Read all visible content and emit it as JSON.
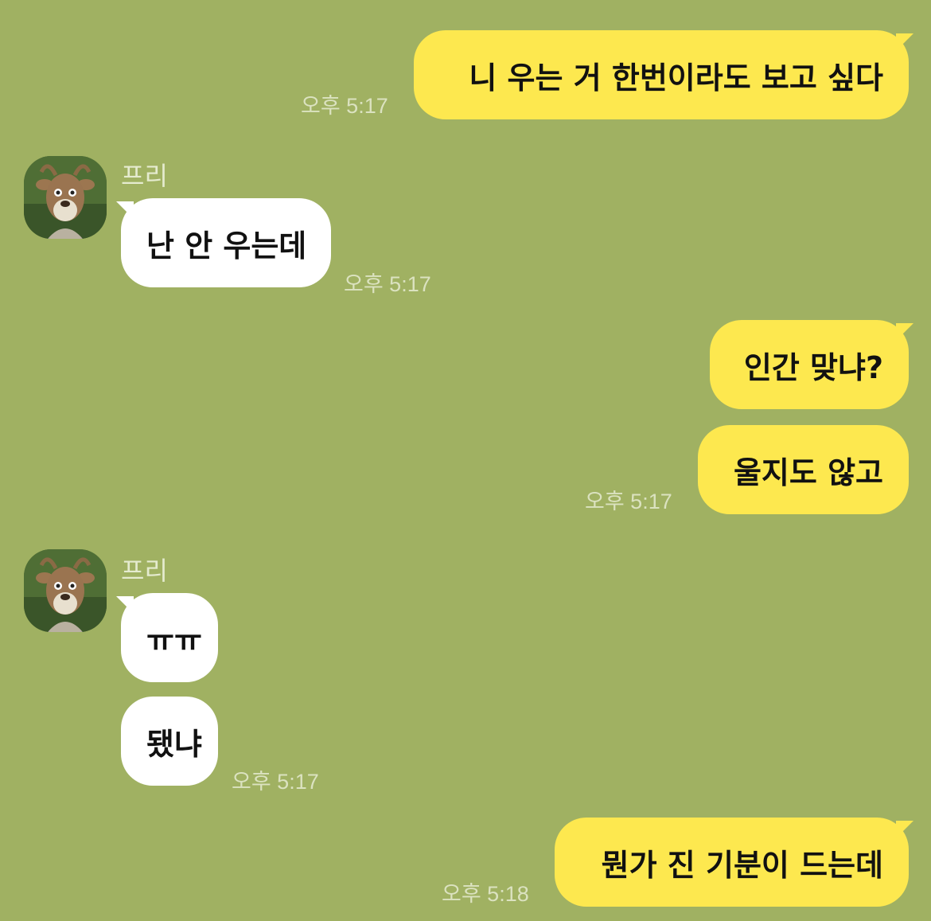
{
  "chat": {
    "partner_name": "프리",
    "messages": [
      {
        "id": "m1",
        "sender": "me",
        "text": "니 우는 거 한번이라도 보고 싶다",
        "time": "오후 5:17"
      },
      {
        "id": "m2",
        "sender": "프리",
        "text": "난 안 우는데",
        "time": "오후 5:17"
      },
      {
        "id": "m3",
        "sender": "me",
        "text": "인간 맞냐?"
      },
      {
        "id": "m4",
        "sender": "me",
        "text": "울지도 않고",
        "time": "오후 5:17"
      },
      {
        "id": "m5",
        "sender": "프리",
        "text": "ㅠㅠ"
      },
      {
        "id": "m6",
        "sender": "프리",
        "text": "됐냐",
        "time": "오후 5:17"
      },
      {
        "id": "m7",
        "sender": "me",
        "text": "뭔가 진 기분이 드는데",
        "time": "오후 5:18"
      }
    ]
  },
  "colors": {
    "background": "#a0b162",
    "my_bubble": "#fde84f",
    "their_bubble": "#ffffff",
    "timestamp": "#dbe2c0"
  },
  "icons": {
    "avatar": "deer-avatar-icon"
  }
}
